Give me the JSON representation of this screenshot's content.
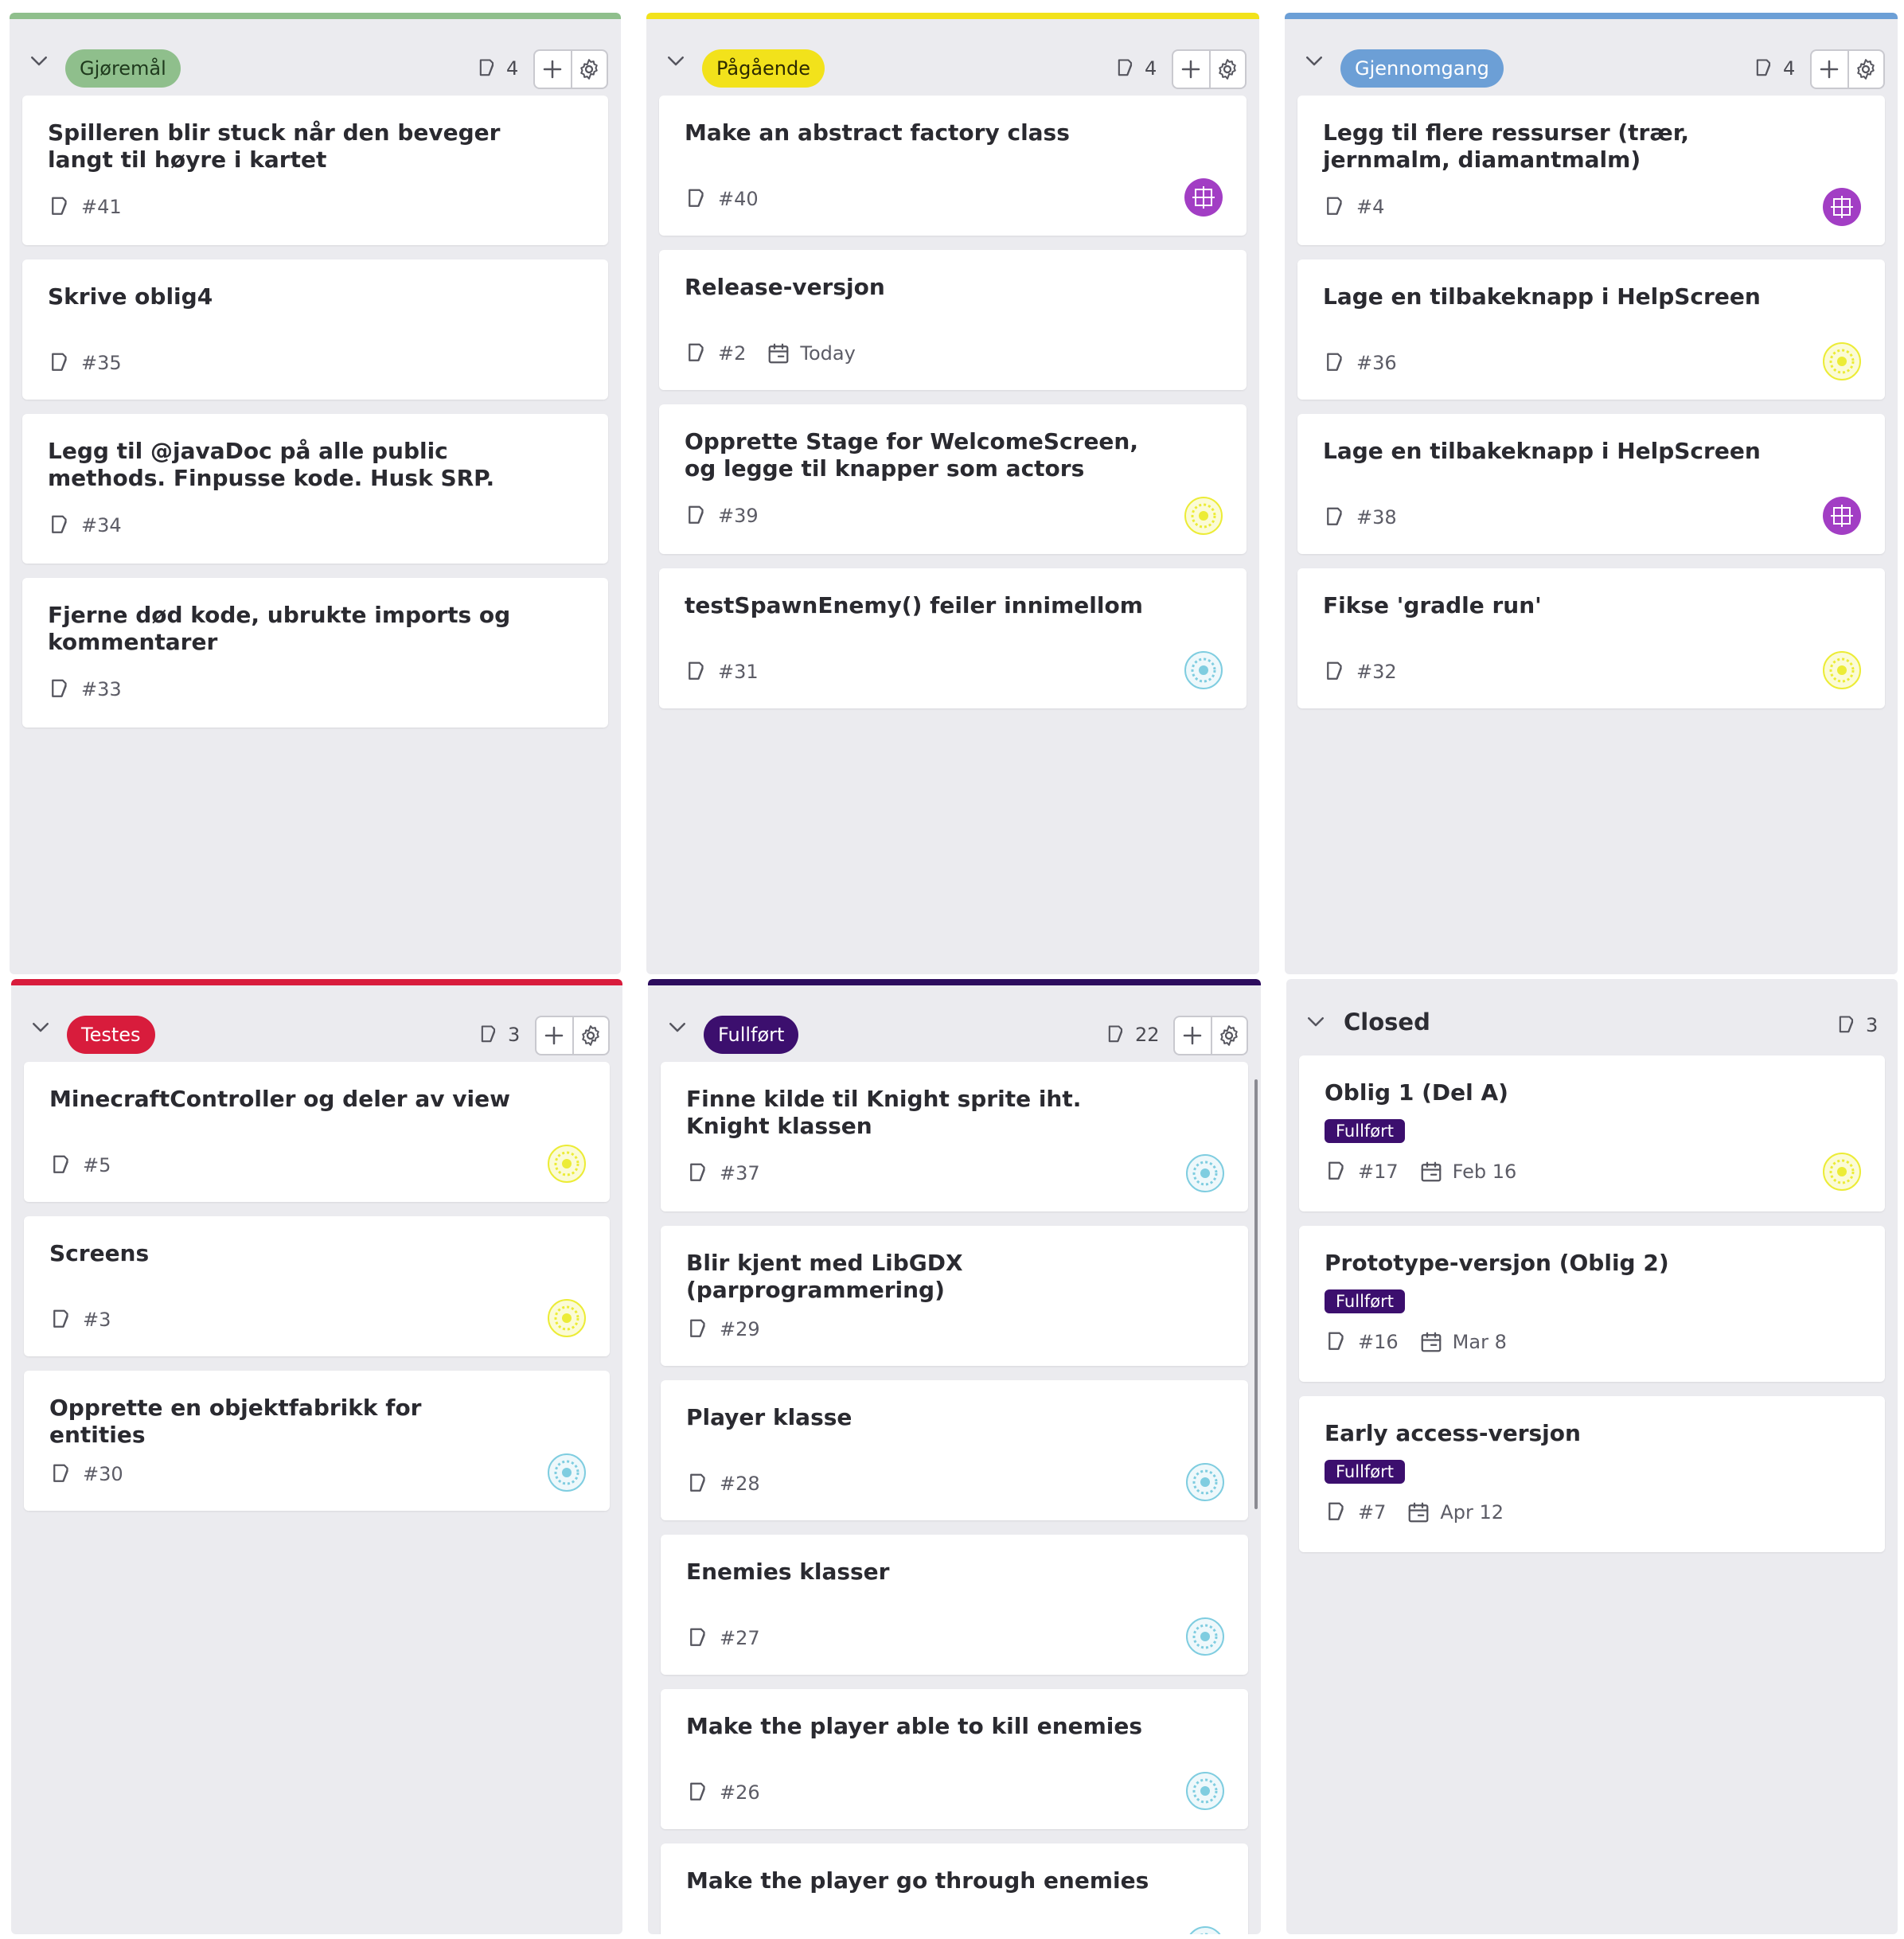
{
  "columns": [
    {
      "key": "gjoremal",
      "label": "Gjøremål",
      "count": "4",
      "accent": "#8fbf8c",
      "pill_bg": "#8fbf8c",
      "pill_fg": "#1f3a1d",
      "cards": [
        {
          "title": "Spilleren blir stuck når den beveger langt til høyre i kartet",
          "id": "#41"
        },
        {
          "title": "Skrive oblig4",
          "id": "#35"
        },
        {
          "title": "Legg til @javaDoc på alle public methods. Finpusse kode. Husk SRP.",
          "id": "#34"
        },
        {
          "title": "Fjerne død kode, ubrukte imports og kommentarer",
          "id": "#33"
        }
      ]
    },
    {
      "key": "pagaende",
      "label": "Pågående",
      "count": "4",
      "accent": "#f2e21b",
      "pill_bg": "#f2e21b",
      "pill_fg": "#2d2a00",
      "cards": [
        {
          "title": "Make an abstract factory class",
          "id": "#40",
          "avatar": "purple"
        },
        {
          "title": "Release-versjon",
          "id": "#2",
          "date": "Today"
        },
        {
          "title": "Opprette Stage for WelcomeScreen, og legge til knapper som actors",
          "id": "#39",
          "avatar": "yellow"
        },
        {
          "title": "testSpawnEnemy() feiler innimellom",
          "id": "#31",
          "avatar": "blue"
        }
      ]
    },
    {
      "key": "gjennomgang",
      "label": "Gjennomgang",
      "count": "4",
      "accent": "#6c9fd6",
      "pill_bg": "#6c9fd6",
      "pill_fg": "#ffffff",
      "cards": [
        {
          "title": "Legg til flere ressurser (trær, jernmalm, diamantmalm)",
          "id": "#4",
          "avatar": "purple"
        },
        {
          "title": "Lage en tilbakeknapp i HelpScreen",
          "id": "#36",
          "avatar": "yellow"
        },
        {
          "title": "Lage en tilbakeknapp i HelpScreen",
          "id": "#38",
          "avatar": "purple"
        },
        {
          "title": "Fikse 'gradle run'",
          "id": "#32",
          "avatar": "yellow"
        }
      ]
    },
    {
      "key": "testes",
      "label": "Testes",
      "count": "3",
      "accent": "#d81c3c",
      "pill_bg": "#d81c3c",
      "pill_fg": "#ffffff",
      "cards": [
        {
          "title": "MinecraftController og deler av view",
          "id": "#5",
          "avatar": "yellow"
        },
        {
          "title": "Screens",
          "id": "#3",
          "avatar": "yellow"
        },
        {
          "title": "Opprette en objektfabrikk for entities",
          "id": "#30",
          "avatar": "blue"
        }
      ]
    },
    {
      "key": "fullfort",
      "label": "Fullført",
      "count": "22",
      "accent": "#2d0d5e",
      "pill_bg": "#3c0f6e",
      "pill_fg": "#ffffff",
      "cards": [
        {
          "title": "Finne kilde til Knight sprite iht. Knight klassen",
          "id": "#37",
          "avatar": "blue"
        },
        {
          "title": "Blir kjent med LibGDX (parprogrammering)",
          "id": "#29"
        },
        {
          "title": "Player klasse",
          "id": "#28",
          "avatar": "blue"
        },
        {
          "title": "Enemies klasser",
          "id": "#27",
          "avatar": "blue"
        },
        {
          "title": "Make the player able to kill enemies",
          "id": "#26",
          "avatar": "blue"
        },
        {
          "title": "Make the player go through enemies",
          "id": "",
          "avatar": "blue"
        }
      ]
    },
    {
      "key": "closed",
      "label": "Closed",
      "count": "3",
      "cards": [
        {
          "title": "Oblig 1 (Del A)",
          "label": "Fullført",
          "id": "#17",
          "date": "Feb 16",
          "avatar": "yellow"
        },
        {
          "title": "Prototype-versjon (Oblig 2)",
          "label": "Fullført",
          "id": "#16",
          "date": "Mar 8"
        },
        {
          "title": "Early access-versjon",
          "label": "Fullført",
          "id": "#7",
          "date": "Apr 12"
        }
      ]
    }
  ],
  "icons": {
    "collapse": "chevron-down-icon",
    "count": "issue-icon",
    "add": "plus-icon",
    "settings": "gear-icon",
    "issue": "issue-icon",
    "date": "calendar-icon"
  },
  "avatar_colors": {
    "purple": "#a23ec4",
    "yellow": "#ecec36",
    "blue": "#7fcde0"
  }
}
